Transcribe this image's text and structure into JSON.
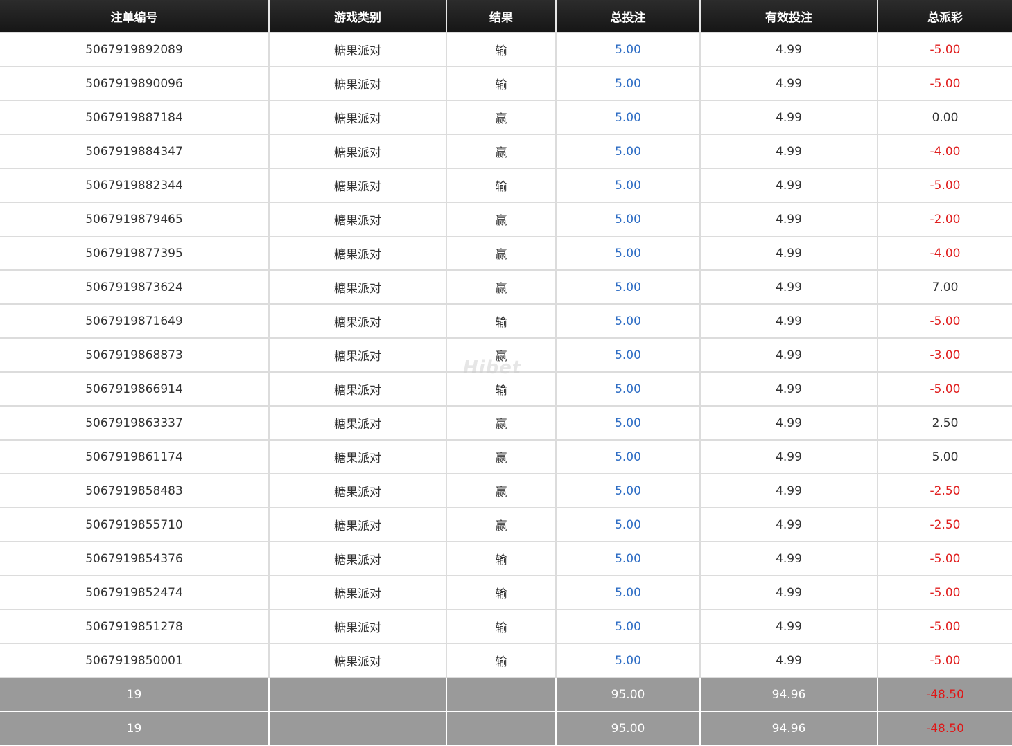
{
  "table": {
    "headers": [
      "注单编号",
      "游戏类别",
      "结果",
      "总投注",
      "有效投注",
      "总派彩"
    ],
    "rows": [
      {
        "id": "5067919892089",
        "game": "糖果派对",
        "result": "输",
        "stake": "5.00",
        "valid": "4.99",
        "payout": "-5.00"
      },
      {
        "id": "5067919890096",
        "game": "糖果派对",
        "result": "输",
        "stake": "5.00",
        "valid": "4.99",
        "payout": "-5.00"
      },
      {
        "id": "5067919887184",
        "game": "糖果派对",
        "result": "赢",
        "stake": "5.00",
        "valid": "4.99",
        "payout": "0.00"
      },
      {
        "id": "5067919884347",
        "game": "糖果派对",
        "result": "赢",
        "stake": "5.00",
        "valid": "4.99",
        "payout": "-4.00"
      },
      {
        "id": "5067919882344",
        "game": "糖果派对",
        "result": "输",
        "stake": "5.00",
        "valid": "4.99",
        "payout": "-5.00"
      },
      {
        "id": "5067919879465",
        "game": "糖果派对",
        "result": "赢",
        "stake": "5.00",
        "valid": "4.99",
        "payout": "-2.00"
      },
      {
        "id": "5067919877395",
        "game": "糖果派对",
        "result": "赢",
        "stake": "5.00",
        "valid": "4.99",
        "payout": "-4.00"
      },
      {
        "id": "5067919873624",
        "game": "糖果派对",
        "result": "赢",
        "stake": "5.00",
        "valid": "4.99",
        "payout": "7.00"
      },
      {
        "id": "5067919871649",
        "game": "糖果派对",
        "result": "输",
        "stake": "5.00",
        "valid": "4.99",
        "payout": "-5.00"
      },
      {
        "id": "5067919868873",
        "game": "糖果派对",
        "result": "赢",
        "stake": "5.00",
        "valid": "4.99",
        "payout": "-3.00"
      },
      {
        "id": "5067919866914",
        "game": "糖果派对",
        "result": "输",
        "stake": "5.00",
        "valid": "4.99",
        "payout": "-5.00"
      },
      {
        "id": "5067919863337",
        "game": "糖果派对",
        "result": "赢",
        "stake": "5.00",
        "valid": "4.99",
        "payout": "2.50"
      },
      {
        "id": "5067919861174",
        "game": "糖果派对",
        "result": "赢",
        "stake": "5.00",
        "valid": "4.99",
        "payout": "5.00"
      },
      {
        "id": "5067919858483",
        "game": "糖果派对",
        "result": "赢",
        "stake": "5.00",
        "valid": "4.99",
        "payout": "-2.50"
      },
      {
        "id": "5067919855710",
        "game": "糖果派对",
        "result": "赢",
        "stake": "5.00",
        "valid": "4.99",
        "payout": "-2.50"
      },
      {
        "id": "5067919854376",
        "game": "糖果派对",
        "result": "输",
        "stake": "5.00",
        "valid": "4.99",
        "payout": "-5.00"
      },
      {
        "id": "5067919852474",
        "game": "糖果派对",
        "result": "输",
        "stake": "5.00",
        "valid": "4.99",
        "payout": "-5.00"
      },
      {
        "id": "5067919851278",
        "game": "糖果派对",
        "result": "输",
        "stake": "5.00",
        "valid": "4.99",
        "payout": "-5.00"
      },
      {
        "id": "5067919850001",
        "game": "糖果派对",
        "result": "输",
        "stake": "5.00",
        "valid": "4.99",
        "payout": "-5.00"
      }
    ],
    "totals": [
      {
        "count": "19",
        "game": "",
        "result": "",
        "stake": "95.00",
        "valid": "94.96",
        "payout": "-48.50"
      },
      {
        "count": "19",
        "game": "",
        "result": "",
        "stake": "95.00",
        "valid": "94.96",
        "payout": "-48.50"
      }
    ]
  },
  "watermark": "Hibet"
}
